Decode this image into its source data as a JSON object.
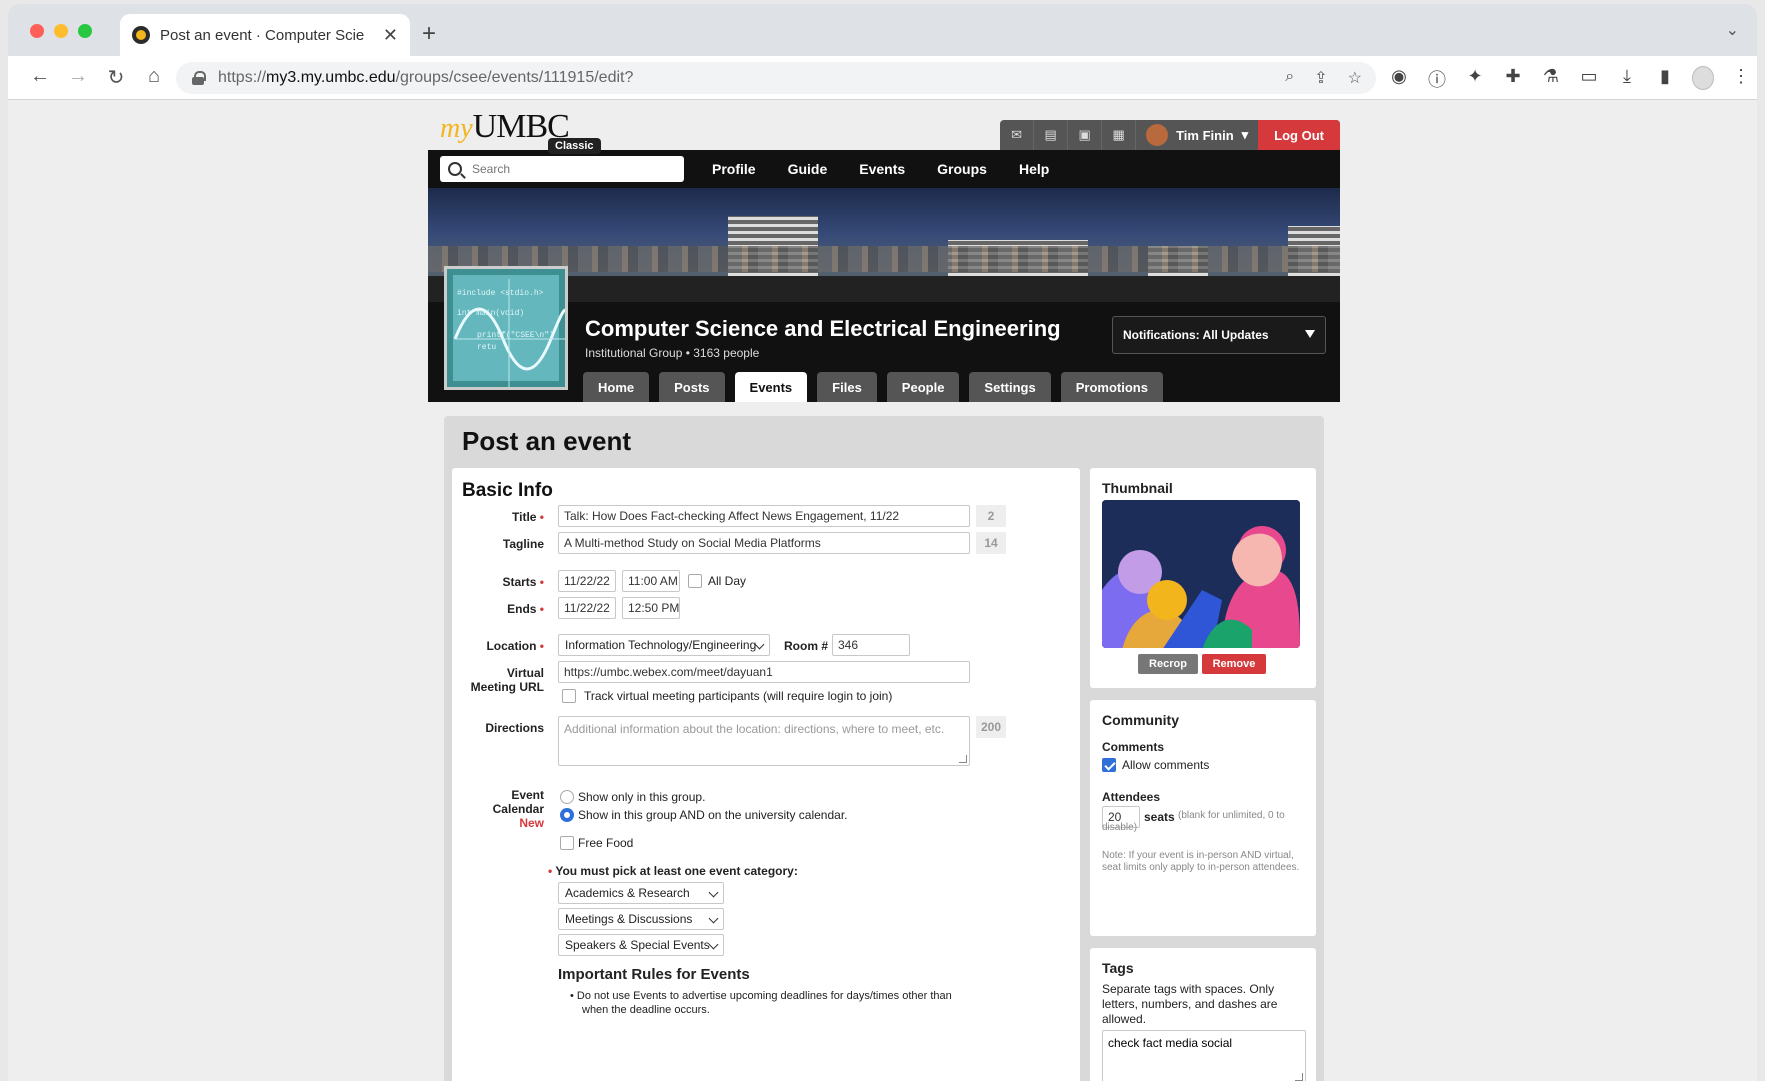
{
  "browser": {
    "tab_title": "Post an event · Computer Scie",
    "url_prefix": "https://",
    "url_host": "my3.my.umbc.edu",
    "url_path": "/groups/csee/events/111915/edit?"
  },
  "site": {
    "logo_my": "my",
    "logo_umbc": "UMBC",
    "logo_badge": "Classic",
    "user_name": "Tim Finin",
    "logout_label": "Log Out",
    "search_placeholder": "Search",
    "nav": [
      "Profile",
      "Guide",
      "Events",
      "Groups",
      "Help"
    ]
  },
  "group": {
    "name": "Computer Science and Electrical Engineering",
    "subtitle": "Institutional Group • 3163 people",
    "notifications": "Notifications: All Updates",
    "thumb_code_1": "#include <stdio.h>",
    "thumb_code_2": "int main(void)",
    "thumb_code_3": "printf(\"CSEE\\n\")",
    "thumb_code_4": "retu",
    "tabs": [
      "Home",
      "Posts",
      "Events",
      "Files",
      "People",
      "Settings",
      "Promotions"
    ]
  },
  "form": {
    "page_title": "Post an event",
    "section_title": "Basic Info",
    "title_label": "Title",
    "title_value": "Talk: How Does Fact-checking Affect News Engagement, 11/22",
    "title_count": "2",
    "tagline_label": "Tagline",
    "tagline_value": "A Multi-method Study on Social Media Platforms",
    "tagline_count": "14",
    "starts_label": "Starts",
    "start_date": "11/22/22",
    "start_time": "11:00 AM",
    "all_day_label": "All Day",
    "ends_label": "Ends",
    "end_date": "11/22/22",
    "end_time": "12:50 PM",
    "location_label": "Location",
    "location_value": "Information Technology/Engineering",
    "room_label": "Room #",
    "room_value": "346",
    "virtual_label_1": "Virtual",
    "virtual_label_2": "Meeting URL",
    "virtual_value": "https://umbc.webex.com/meet/dayuan1",
    "track_label": "Track virtual meeting participants (will require login to join)",
    "directions_label": "Directions",
    "directions_placeholder": "Additional information about the location: directions, where to meet, etc.",
    "directions_count": "200",
    "calendar_label_1": "Event",
    "calendar_label_2": "Calendar",
    "calendar_label_new": "New",
    "calendar_opt_1": "Show only in this group.",
    "calendar_opt_2": "Show in this group AND on the university calendar.",
    "free_food_label": "Free Food",
    "category_prompt": "You must pick at least one event category:",
    "categories": [
      "Academics & Research",
      "Meetings & Discussions",
      "Speakers & Special Events"
    ],
    "rules_title": "Important Rules for Events",
    "rule_1": "Do not use Events to advertise upcoming deadlines for days/times other than",
    "rule_1_cont": "when the deadline occurs."
  },
  "thumbnail": {
    "title": "Thumbnail",
    "recrop_label": "Recrop",
    "remove_label": "Remove"
  },
  "community": {
    "title": "Community",
    "comments_label": "Comments",
    "allow_comments_label": "Allow comments",
    "attendees_label": "Attendees",
    "seats_value": "20",
    "seats_label": "seats",
    "seats_hint": "(blank for unlimited, 0 to disable)",
    "note": "Note: If your event is in-person AND virtual, seat limits only apply to in-person attendees."
  },
  "tags": {
    "title": "Tags",
    "help": "Separate tags with spaces. Only letters, numbers, and dashes are allowed.",
    "value": "check fact media social"
  },
  "colors": {
    "accent_red": "#d5393c",
    "logo_gold": "#f2b51c",
    "nav_black": "#111111",
    "checkbox_blue": "#2f6fda"
  }
}
